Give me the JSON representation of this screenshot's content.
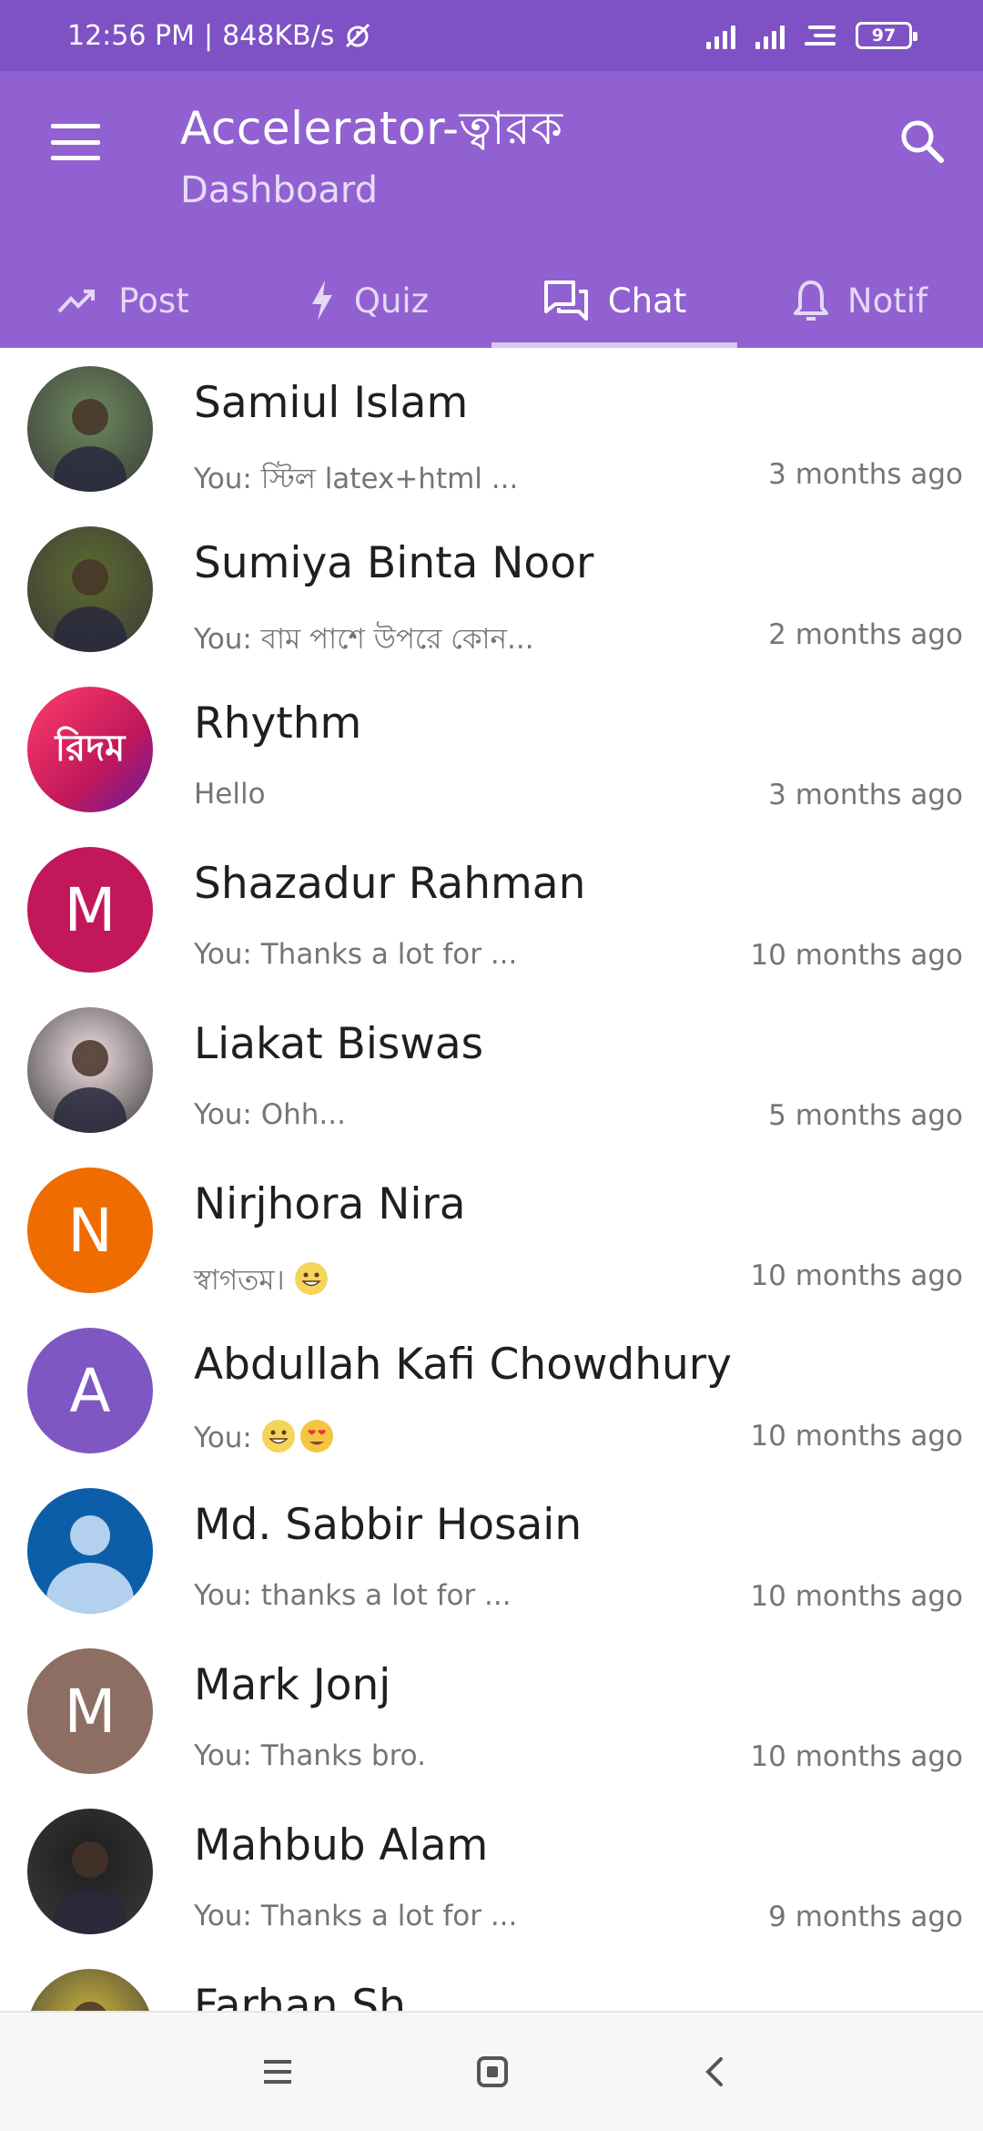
{
  "status_bar": {
    "time": "12:56 PM",
    "network_speed": "848KB/s",
    "battery": "97"
  },
  "header": {
    "title": "Accelerator-ত্বারক",
    "subtitle": "Dashboard"
  },
  "tabs": [
    {
      "label": "Post",
      "icon": "trending-icon"
    },
    {
      "label": "Quiz",
      "icon": "lightning-icon"
    },
    {
      "label": "Chat",
      "icon": "chat-icon",
      "active": true
    },
    {
      "label": "Notif",
      "icon": "bell-icon"
    }
  ],
  "chats": [
    {
      "name": "Samiul Islam",
      "preview": "You: স্টিল latex+html ...",
      "time": "3 months ago",
      "avatar_type": "photo",
      "avatar_color": "#6d8a5c"
    },
    {
      "name": "Sumiya Binta Noor",
      "preview": "You: বাম পাশে উপরে কোন...",
      "time": "2 months ago",
      "avatar_type": "photo",
      "avatar_color": "#5d6b2e"
    },
    {
      "name": "Rhythm",
      "preview": "Hello",
      "time": "3 months ago",
      "avatar_type": "logo",
      "avatar_text": "রিদম",
      "avatar_color": "#e0245e"
    },
    {
      "name": "Shazadur Rahman",
      "preview": "You: Thanks a lot for ...",
      "time": "10 months ago",
      "avatar_type": "letter",
      "avatar_text": "M",
      "avatar_color": "#c2185b"
    },
    {
      "name": "Liakat Biswas",
      "preview": "You: Ohh...",
      "time": "5 months ago",
      "avatar_type": "photo",
      "avatar_color": "#f1dfe2"
    },
    {
      "name": "Nirjhora Nira",
      "preview": "স্বাগতম।",
      "time": "10 months ago",
      "avatar_type": "letter",
      "avatar_text": "N",
      "avatar_color": "#ef6c00",
      "emojis": [
        "grin"
      ]
    },
    {
      "name": "Abdullah Kafi Chowdhury",
      "preview": "You:",
      "time": "10 months ago",
      "avatar_type": "letter",
      "avatar_text": "A",
      "avatar_color": "#7e57c2",
      "emojis": [
        "grin",
        "heart-eyes"
      ]
    },
    {
      "name": "Md. Sabbir Hosain",
      "preview": "You: thanks a lot for ...",
      "time": "10 months ago",
      "avatar_type": "default",
      "avatar_color": "#0d5ea8"
    },
    {
      "name": "Mark Jonj",
      "preview": "You: Thanks bro.",
      "time": "10 months ago",
      "avatar_type": "letter",
      "avatar_text": "M",
      "avatar_color": "#8d6e63"
    },
    {
      "name": "Mahbub Alam",
      "preview": "You: Thanks a lot for ...",
      "time": "9 months ago",
      "avatar_type": "photo",
      "avatar_color": "#1e1e1e"
    },
    {
      "name": "Farhan Sh...",
      "preview": "",
      "time": "",
      "avatar_type": "photo",
      "avatar_color": "#c9b23a"
    }
  ],
  "colors": {
    "status_bar": "#7e52c4",
    "header": "#9161d1"
  }
}
